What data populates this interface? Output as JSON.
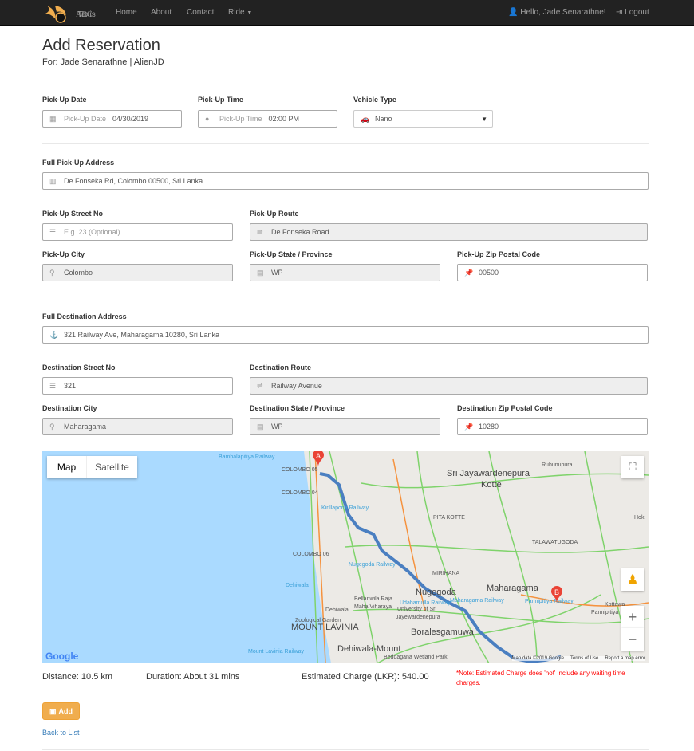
{
  "nav": {
    "brand_top": "ABC",
    "brand_bottom": "Taxis",
    "links": [
      "Home",
      "About",
      "Contact",
      "Ride"
    ],
    "greeting": "Hello, Jade Senarathne!",
    "logout": "Logout"
  },
  "page": {
    "title": "Add Reservation",
    "subtitle": "For: Jade Senarathne | AlienJD"
  },
  "trip": {
    "date": {
      "label": "Pick-Up Date",
      "prefix": "Pick-Up Date",
      "value": "04/30/2019",
      "icon": "calendar-icon"
    },
    "time": {
      "label": "Pick-Up Time",
      "prefix": "Pick-Up Time",
      "value": "02:00 PM",
      "icon": "clock-icon"
    },
    "vehicle": {
      "label": "Vehicle Type",
      "value": "Nano",
      "icon": "car-icon"
    }
  },
  "pickup": {
    "full": {
      "label": "Full Pick-Up Address",
      "value": "De Fonseka Rd, Colombo 00500, Sri Lanka"
    },
    "street": {
      "label": "Pick-Up Street No",
      "placeholder": "E.g. 23 (Optional)"
    },
    "route": {
      "label": "Pick-Up Route",
      "value": "De Fonseka Road"
    },
    "city": {
      "label": "Pick-Up City",
      "value": "Colombo"
    },
    "state": {
      "label": "Pick-Up State / Province",
      "value": "WP"
    },
    "zip": {
      "label": "Pick-Up Zip Postal Code",
      "value": "00500"
    }
  },
  "dest": {
    "full": {
      "label": "Full Destination Address",
      "value": "321 Railway Ave, Maharagama 10280, Sri Lanka"
    },
    "street": {
      "label": "Destination Street No",
      "value": "321"
    },
    "route": {
      "label": "Destination Route",
      "value": "Railway Avenue"
    },
    "city": {
      "label": "Destination City",
      "value": "Maharagama"
    },
    "state": {
      "label": "Destination State / Province",
      "value": "WP"
    },
    "zip": {
      "label": "Destination Zip Postal Code",
      "value": "10280"
    }
  },
  "map": {
    "tab_map": "Map",
    "tab_satellite": "Satellite",
    "marker_a": "A",
    "marker_b": "B",
    "google": "Google",
    "footer": [
      "Map data ©2019 Google",
      "Terms of Use",
      "Report a map error"
    ],
    "labels": [
      "Bambalapitiya Railway",
      "COLOMBO 05",
      "Beddagana Wetland Park",
      "Sri Jayawardenepura",
      "Kotte",
      "COLOMBO 04",
      "Kirillapona Railway",
      "PITA KOTTE",
      "TALAWATUGODA",
      "COLOMBO 06",
      "Nugegoda Railway",
      "MIRIHANA",
      "Ruhunupura",
      "Nugegoda",
      "Udahamulla Railway",
      "Dehiwala",
      "Zoological Garden",
      "University of Sri",
      "Jayewardenepura",
      "Dehiwala",
      "Maharagama",
      "Bellanwila Raja",
      "Maha Viharaya",
      "Maharagama Railway",
      "Pannipitiya Railway",
      "Kottawa",
      "Pannipitiya",
      "Boralesgamuwa",
      "MOUNT LAVINIA",
      "Mount Lavinia Railway",
      "Dehiwala-Mount",
      "Hok"
    ],
    "colors": {
      "sea": "#aadaff",
      "land": "#eceae6",
      "route": "#4a7fc1",
      "marker": "#ea4335"
    }
  },
  "summary": {
    "distance": "Distance: 10.5 km",
    "duration": "Duration: About 31 mins",
    "charge": "Estimated Charge (LKR): 540.00",
    "note": "*Note: Estimated Charge does 'not' include any waiting time charges."
  },
  "actions": {
    "add": "Add",
    "back": "Back to List"
  }
}
